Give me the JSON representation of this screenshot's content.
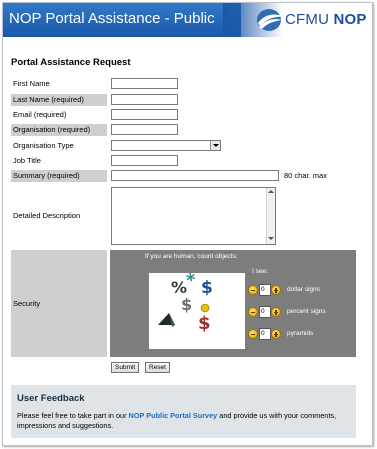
{
  "header": {
    "title": "NOP Portal Assistance - Public",
    "logo_text_light": "CFMU",
    "logo_text_bold": "NOP"
  },
  "form": {
    "heading": "Portal Assistance Request",
    "first_name": {
      "label": "First Name",
      "value": ""
    },
    "last_name": {
      "label": "Last Name (required)",
      "value": ""
    },
    "email": {
      "label": "Email (required)",
      "value": ""
    },
    "organisation": {
      "label": "Organisation (required)",
      "value": ""
    },
    "organisation_type": {
      "label": "Organisation Type",
      "value": ""
    },
    "job_title": {
      "label": "Job Title",
      "value": ""
    },
    "summary": {
      "label": "Summary (required)",
      "value": "",
      "hint": "80 char. max"
    },
    "description": {
      "label": "Detailed Description",
      "value": ""
    }
  },
  "security": {
    "label": "Security",
    "prompt": "If you are human, count objects:",
    "i_see": "I see:",
    "counters": [
      {
        "value": "0",
        "label": "dollar signs"
      },
      {
        "value": "0",
        "label": "percent signs"
      },
      {
        "value": "0",
        "label": "pyramids"
      }
    ]
  },
  "buttons": {
    "submit": "Submit",
    "reset": "Reset"
  },
  "feedback": {
    "title": "User Feedback",
    "text_before": "Please feel free to take part in our ",
    "link": "NOP Public Portal Survey",
    "text_after": " and provide us with your comments, impressions and suggestions."
  },
  "colors": {
    "header_blue": "#1b58a8",
    "required_label_bg": "#cfcfcf",
    "captcha_panel": "#7d7d7d",
    "feedback_bg": "#dee4e8",
    "link": "#1f6fbf"
  }
}
